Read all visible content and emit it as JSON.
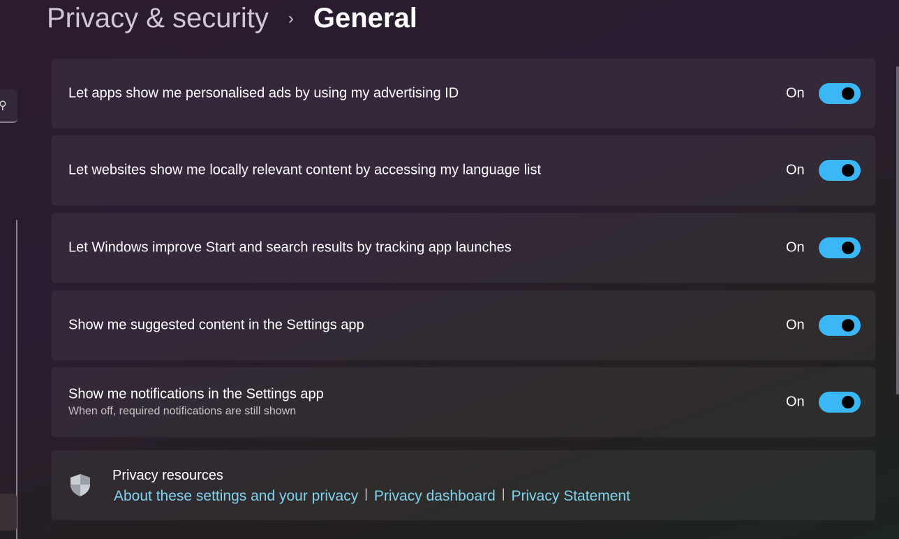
{
  "breadcrumb": {
    "parent": "Privacy & security",
    "separator": "›",
    "current": "General"
  },
  "settings": [
    {
      "label": "Let apps show me personalised ads by using my advertising ID",
      "state": "On",
      "on": true
    },
    {
      "label": "Let websites show me locally relevant content by accessing my language list",
      "state": "On",
      "on": true
    },
    {
      "label": "Let Windows improve Start and search results by tracking app launches",
      "state": "On",
      "on": true
    },
    {
      "label": "Show me suggested content in the Settings app",
      "state": "On",
      "on": true
    },
    {
      "label": "Show me notifications in the Settings app",
      "description": "When off, required notifications are still shown",
      "state": "On",
      "on": true
    }
  ],
  "resources": {
    "title": "Privacy resources",
    "links": [
      "About these settings and your privacy",
      "Privacy dashboard",
      "Privacy Statement"
    ],
    "separator": "|"
  },
  "colors": {
    "accent": "#3cb7f5",
    "link": "#7fd3ee"
  },
  "icons": {
    "search": "search-icon",
    "shield": "shield-icon"
  }
}
